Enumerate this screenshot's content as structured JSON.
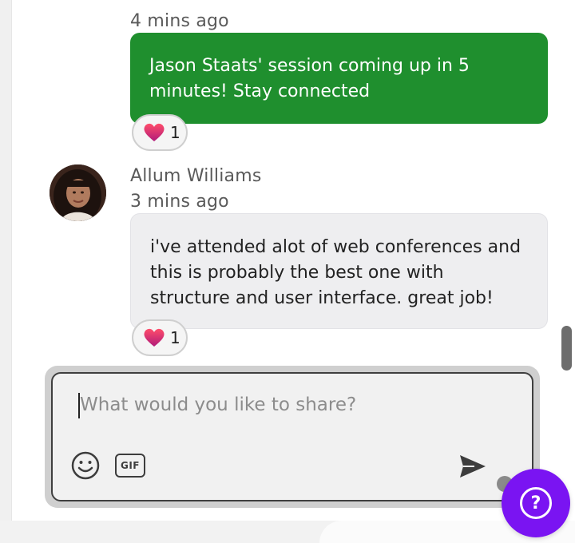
{
  "chat": {
    "messages": [
      {
        "timestamp": "4 mins ago",
        "text": "Jason Staats' session coming up in 5 minutes! Stay connected",
        "reaction_count": "1"
      },
      {
        "author": "Allum Williams",
        "timestamp": "3 mins ago",
        "text": "i've attended alot of web conferences and this is probably the best one with structure and user interface. great job!",
        "reaction_count": "1"
      }
    ]
  },
  "composer": {
    "placeholder": "What would you like to share?",
    "gif_label": "GIF"
  },
  "help": {
    "label": "?"
  },
  "colors": {
    "organizer_bubble": "#1f8f2e",
    "attendee_bubble": "#eeeef0",
    "help_button": "#7a14f2",
    "heart": "#e0284a"
  },
  "icons": {
    "reaction": "heart-icon",
    "emoji": "smiley-icon",
    "send": "send-icon"
  }
}
